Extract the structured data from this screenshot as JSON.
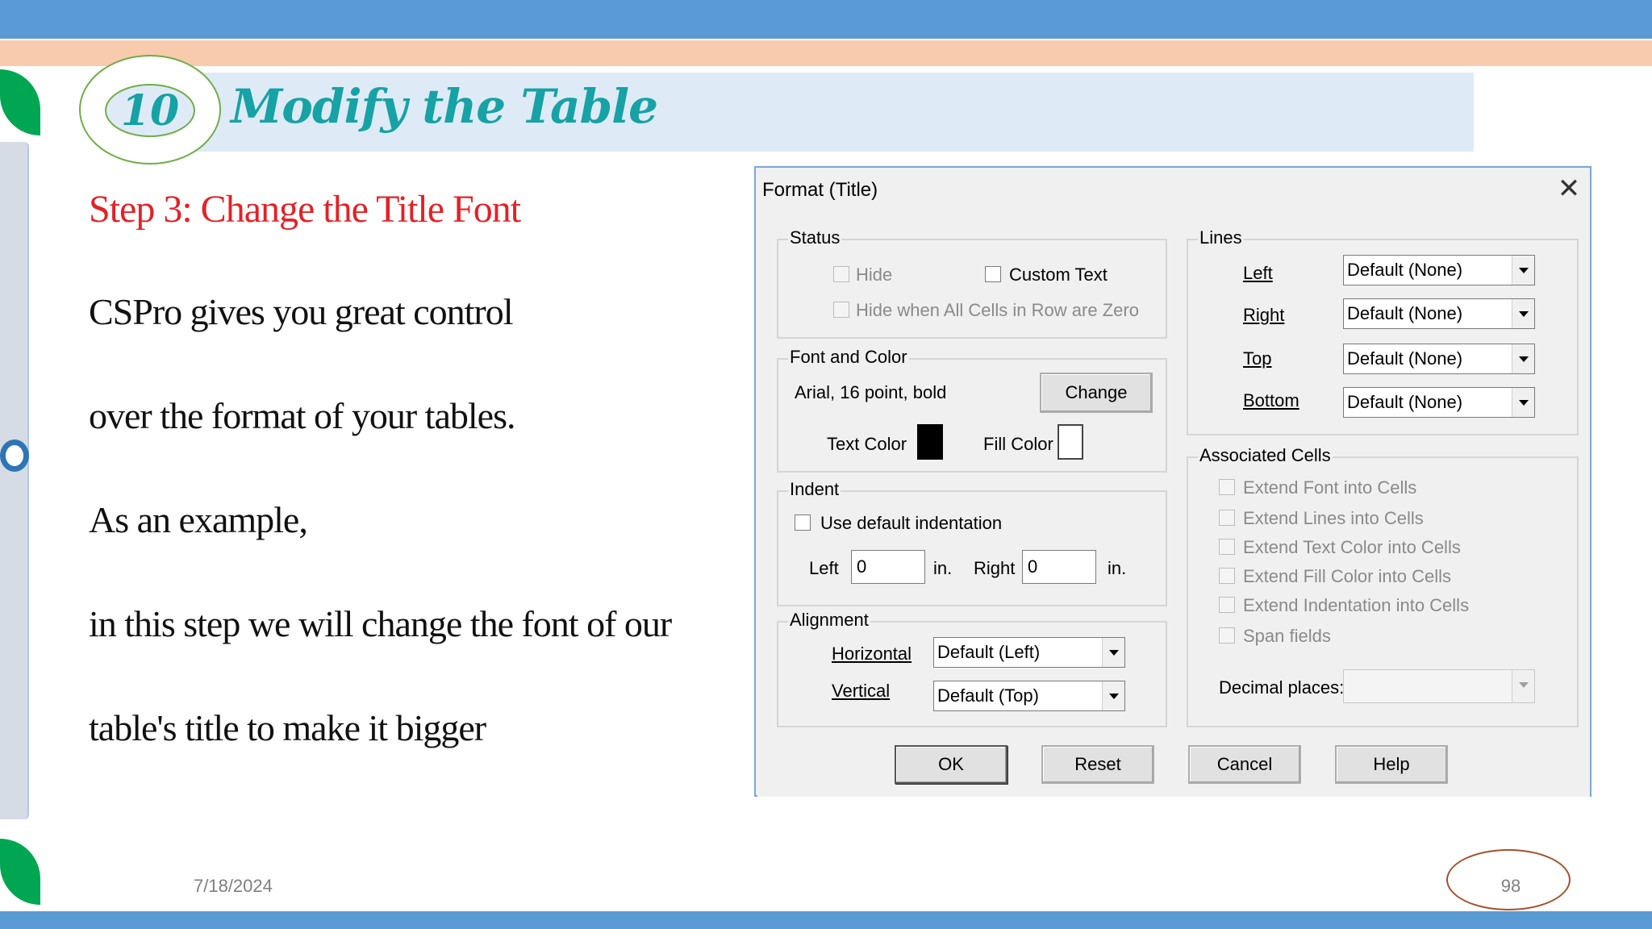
{
  "slide": {
    "number": "10",
    "title": "Modify the Table",
    "step_heading": "Step 3: Change the Title Font",
    "body_lines": [
      "CSPro gives you great control",
      "over the format of your tables.",
      "As an example,",
      "in this step we will change the font of our",
      "table's title to make it bigger"
    ],
    "footer_date": "7/18/2024",
    "page_number": "98"
  },
  "dialog": {
    "title": "Format (Title)",
    "close_icon": "close-icon",
    "status": {
      "label": "Status",
      "hide": "Hide",
      "custom_text": "Custom Text",
      "hide_when_zero": "Hide when All Cells in Row are Zero"
    },
    "font_color": {
      "label": "Font and Color",
      "font_desc": "Arial, 16 point, bold",
      "change_button": "Change",
      "text_color_label": "Text Color",
      "fill_color_label": "Fill Color",
      "text_color": "#000000",
      "fill_color": "#ffffff"
    },
    "indent": {
      "label": "Indent",
      "use_default": "Use default indentation",
      "left_label": "Left",
      "left_value": "0",
      "right_label": "Right",
      "right_value": "0",
      "unit_left": "in.",
      "unit_right": "in."
    },
    "alignment": {
      "label": "Alignment",
      "horizontal_label": "Horizontal",
      "horizontal_value": "Default (Left)",
      "vertical_label": "Vertical",
      "vertical_value": "Default (Top)"
    },
    "lines": {
      "label": "Lines",
      "left_label": "Left",
      "left_value": "Default (None)",
      "right_label": "Right",
      "right_value": "Default (None)",
      "top_label": "Top",
      "top_value": "Default (None)",
      "bottom_label": "Bottom",
      "bottom_value": "Default (None)"
    },
    "associated": {
      "label": "Associated Cells",
      "items": [
        "Extend Font into Cells",
        "Extend Lines into Cells",
        "Extend Text Color into Cells",
        "Extend Fill Color into Cells",
        "Extend Indentation into Cells",
        "Span fields"
      ],
      "decimal_label": "Decimal places:",
      "decimal_value": ""
    },
    "buttons": {
      "ok": "OK",
      "reset": "Reset",
      "cancel": "Cancel",
      "help": "Help"
    }
  }
}
